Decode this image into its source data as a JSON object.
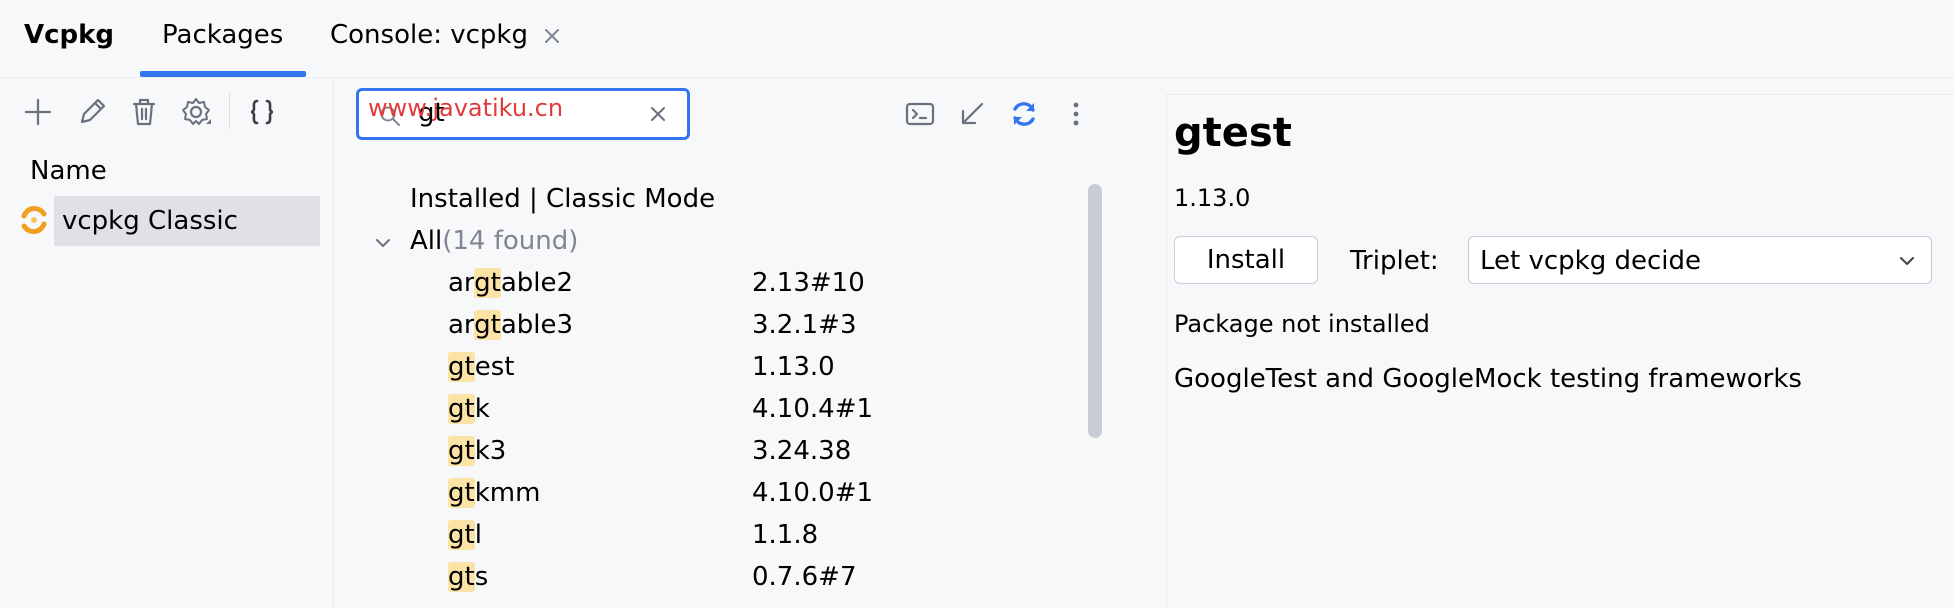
{
  "header": {
    "app_title": "Vcpkg",
    "tabs": [
      {
        "label": "Packages",
        "active": true
      },
      {
        "label": "Console: vcpkg",
        "closable": true
      }
    ],
    "accent_color": "#3574f0"
  },
  "left_panel": {
    "toolbar": [
      "add-icon",
      "edit-icon",
      "delete-icon",
      "settings-icon",
      "json-braces-icon"
    ],
    "column_header": "Name",
    "items": [
      {
        "label": "vcpkg Classic",
        "selected": true,
        "icon": "vcpkg-logo-icon"
      }
    ]
  },
  "search": {
    "value": "gt",
    "watermark": "www.javatiku.cn"
  },
  "middle_toolbar": [
    "terminal-icon",
    "collapse-arrow-icon",
    "refresh-icon",
    "more-vertical-icon"
  ],
  "package_list": {
    "header": "Installed | Classic Mode",
    "group_label": "All",
    "group_count": "(14 found)",
    "packages": [
      {
        "prefix": "ar",
        "match": "gt",
        "suffix": "able2",
        "version": "2.13#10"
      },
      {
        "prefix": "ar",
        "match": "gt",
        "suffix": "able3",
        "version": "3.2.1#3"
      },
      {
        "prefix": "",
        "match": "gt",
        "suffix": "est",
        "version": "1.13.0"
      },
      {
        "prefix": "",
        "match": "gt",
        "suffix": "k",
        "version": "4.10.4#1"
      },
      {
        "prefix": "",
        "match": "gt",
        "suffix": "k3",
        "version": "3.24.38"
      },
      {
        "prefix": "",
        "match": "gt",
        "suffix": "kmm",
        "version": "4.10.0#1"
      },
      {
        "prefix": "",
        "match": "gt",
        "suffix": "l",
        "version": "1.1.8"
      },
      {
        "prefix": "",
        "match": "gt",
        "suffix": "s",
        "version": "0.7.6#7"
      }
    ],
    "highlight_color": "#fbe3a5"
  },
  "details": {
    "title": "gtest",
    "version": "1.13.0",
    "install_label": "Install",
    "triplet_label": "Triplet:",
    "triplet_value": "Let vcpkg decide",
    "status": "Package not installed",
    "description": "GoogleTest and GoogleMock testing frameworks"
  }
}
